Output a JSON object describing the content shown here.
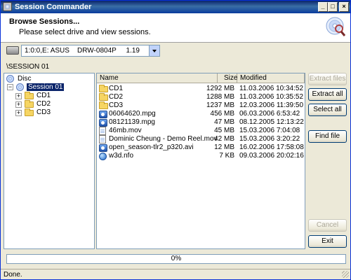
{
  "window": {
    "title": "Session Commander"
  },
  "header": {
    "title": "Browse Sessions...",
    "subtitle": "Please select drive and view sessions."
  },
  "drive": {
    "selected": "1:0:0,E: ASUS    DRW-0804P     1.19"
  },
  "path": "\\SESSION 01",
  "tree": {
    "root": "Disc",
    "session": "Session 01",
    "children": [
      "CD1",
      "CD2",
      "CD3"
    ]
  },
  "filelist": {
    "columns": {
      "name": "Name",
      "size": "Size",
      "modified": "Modified"
    },
    "rows": [
      {
        "icon": "folder-icon",
        "name": "CD1",
        "size": "1292 MB",
        "modified": "11.03.2006 10:34:52"
      },
      {
        "icon": "folder-icon",
        "name": "CD2",
        "size": "1288 MB",
        "modified": "11.03.2006 10:35:52"
      },
      {
        "icon": "folder-icon",
        "name": "CD3",
        "size": "1237 MB",
        "modified": "12.03.2006 11:39:50"
      },
      {
        "icon": "media-file-icon",
        "name": "06064620.mpg",
        "size": "456 MB",
        "modified": "06.03.2006 6:53:42"
      },
      {
        "icon": "media-file-icon",
        "name": "08121139.mpg",
        "size": "47 MB",
        "modified": "08.12.2005 12:13:22"
      },
      {
        "icon": "document-icon",
        "name": "46mb.mov",
        "size": "45 MB",
        "modified": "15.03.2006 7:04:08"
      },
      {
        "icon": "document-icon",
        "name": "Dominic Cheung - Demo Reel.mov",
        "size": "42 MB",
        "modified": "15.03.2006 3:20:22"
      },
      {
        "icon": "media-file-icon",
        "name": "open_season-tlr2_p320.avi",
        "size": "12 MB",
        "modified": "16.02.2006 17:58:08"
      },
      {
        "icon": "web-document-icon",
        "name": "w3d.nfo",
        "size": "7 KB",
        "modified": "09.03.2006 20:02:16"
      }
    ]
  },
  "buttons": {
    "extract_files": "Extract files",
    "extract_all": "Extract all",
    "select_all": "Select all",
    "find_file": "Find file",
    "cancel": "Cancel",
    "exit": "Exit"
  },
  "progress": {
    "label": "0%",
    "value": 0
  },
  "status": "Done."
}
